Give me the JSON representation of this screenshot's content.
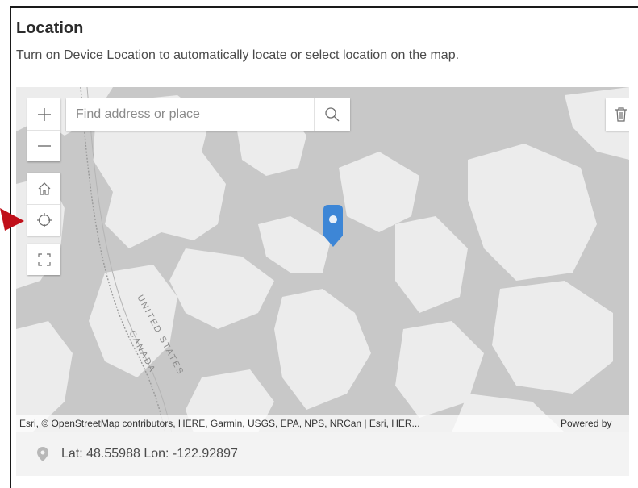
{
  "section": {
    "title": "Location",
    "description": "Turn on Device Location to automatically locate or select location on the map."
  },
  "map": {
    "search_placeholder": "Find address or place",
    "labels": {
      "border_us": "UNITED STATES",
      "border_ca": "CANADA"
    },
    "attribution": "Esri, © OpenStreetMap contributors, HERE, Garmin, USGS, EPA, NPS, NRCan | Esri, HER...",
    "powered_by": "Powered by",
    "pin_color": "#3d86d6",
    "water_color": "#c8c8c8",
    "land_color": "#ececec"
  },
  "tools": {
    "zoom_in": "zoom-in",
    "zoom_out": "zoom-out",
    "home": "home",
    "locate": "locate",
    "fullscreen": "fullscreen",
    "delete": "delete"
  },
  "coordinates": {
    "text": "Lat: 48.55988  Lon: -122.92897"
  },
  "annotation": {
    "arrow_color": "#c0101a"
  }
}
